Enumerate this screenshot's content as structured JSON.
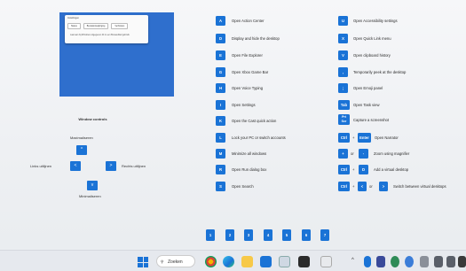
{
  "preview": {
    "window_title": "Instellingen",
    "chips": [
      "Status",
      "Bij stationswijziging",
      "Verbinden"
    ],
    "note": "Laat aan bij Windows uitgegeven dit in een Bureaublad gebruik"
  },
  "window_controls": {
    "title": "Window controls",
    "maximize": "Maximaliseren",
    "snap_left": "Links uitlijnen",
    "snap_right": "Rechts uitlijnen",
    "minimize": "Minimaliseren",
    "arrow_up": "^",
    "arrow_left": "<",
    "arrow_right": ">",
    "arrow_down": "v"
  },
  "left_shortcuts": [
    {
      "key": "A",
      "desc": "Open Action Center"
    },
    {
      "key": "D",
      "desc": "Display and hide the desktop"
    },
    {
      "key": "E",
      "desc": "Open File Explorer"
    },
    {
      "key": "G",
      "desc": "Open Xbox Game Bar"
    },
    {
      "key": "H",
      "desc": "Open Voice Typing"
    },
    {
      "key": "I",
      "desc": "Open Settings"
    },
    {
      "key": "K",
      "desc": "Open the Cast quick action"
    },
    {
      "key": "L",
      "desc": "Lock your PC or switch accounts"
    },
    {
      "key": "M",
      "desc": "Minimize all windows"
    },
    {
      "key": "R",
      "desc": "Open Run dialog box"
    },
    {
      "key": "S",
      "desc": "Open Search"
    }
  ],
  "right_shortcuts": {
    "r0": {
      "key": "U",
      "desc": "Open Accessibility settings"
    },
    "r1": {
      "key": "X",
      "desc": "Open Quick Link menu"
    },
    "r2": {
      "key": "V",
      "desc": "Open clipboard history"
    },
    "r3": {
      "key": ",",
      "desc": "Temporarily peek at the desktop"
    },
    "r4": {
      "key": ";",
      "desc": "Open Emoji panel"
    },
    "r5": {
      "key": "Tab",
      "desc": "Open Task view"
    },
    "r6": {
      "key1": "Prt",
      "key2": "Scr",
      "desc": "Capture a screenshot"
    },
    "r7": {
      "key1": "Ctrl",
      "plus": "+",
      "key2": "Enter",
      "desc": "Open Narrator"
    },
    "r8": {
      "key1": "+",
      "or": "or",
      "key2": "-",
      "desc": "Zoom using magnifier"
    },
    "r9": {
      "key1": "Ctrl",
      "plus": "+",
      "key2": "D",
      "desc": "Add a virtual desktop"
    },
    "r10": {
      "key1": "Ctrl",
      "plus": "+",
      "key2": "<",
      "or": "or",
      "key3": ">",
      "desc": "Switch between virtual desktops"
    }
  },
  "number_keys": [
    "1",
    "2",
    "3",
    "4",
    "5",
    "6",
    "7"
  ],
  "taskbar": {
    "search_label": "Zoeken",
    "search_icon": "search-icon",
    "tray_chevron": "^",
    "colors": {
      "accent": "#1a73d6"
    }
  }
}
